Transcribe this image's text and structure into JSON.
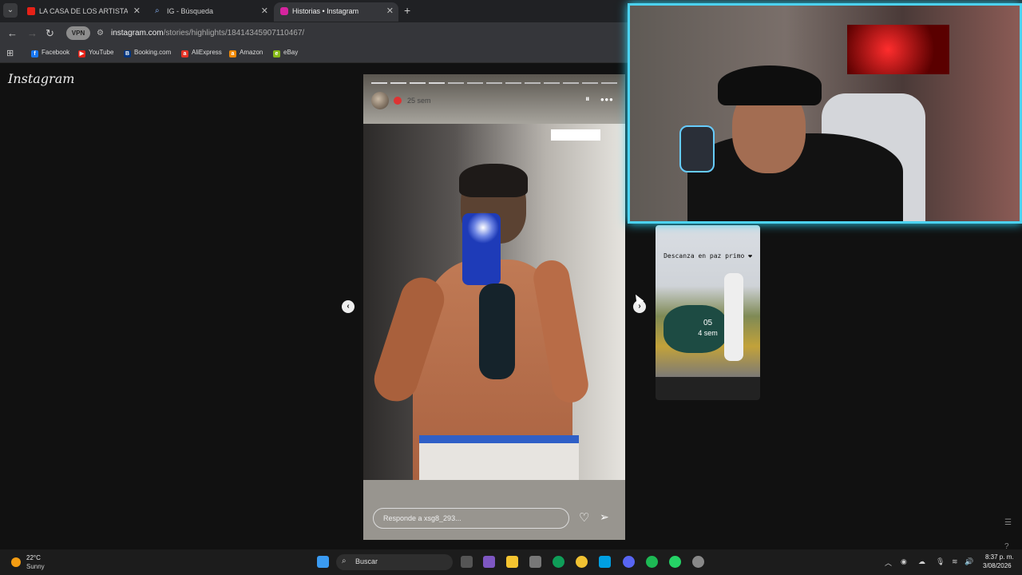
{
  "browser": {
    "tabs": [
      {
        "label": "LA CASA DE LOS ARTISTAS: OV",
        "favicon_color": "#e62117"
      },
      {
        "label": "IG - Búsqueda",
        "favicon_color": "#8ab4f8"
      },
      {
        "label": "Historias • Instagram",
        "favicon_color": "#d6249f"
      }
    ],
    "new_tab_symbol": "+",
    "vpn_label": "VPN",
    "url_domain": "instagram.com",
    "url_path": "/stories/highlights/18414345907110467/",
    "bookmarks": [
      {
        "label": "Facebook",
        "icon": "facebook-icon",
        "color": "#1877f2",
        "glyph": "f"
      },
      {
        "label": "YouTube",
        "icon": "youtube-icon",
        "color": "#e62117",
        "glyph": "▶"
      },
      {
        "label": "Booking.com",
        "icon": "booking-icon",
        "color": "#003580",
        "glyph": "B"
      },
      {
        "label": "AliExpress",
        "icon": "aliexpress-icon",
        "color": "#e43225",
        "glyph": "a"
      },
      {
        "label": "Amazon",
        "icon": "amazon-icon",
        "color": "#f08804",
        "glyph": "a"
      },
      {
        "label": "eBay",
        "icon": "ebay-icon",
        "color": "#86b817",
        "glyph": "e"
      }
    ]
  },
  "instagram": {
    "logo": "Instagram",
    "story": {
      "time_ago": "25 sem",
      "reply_placeholder": "Responde a xsg8_293...",
      "pause_symbol": "⏸",
      "more_symbol": "•••"
    },
    "next_thumb": {
      "caption": "Descanza en paz primo ❤",
      "day": "05",
      "age": "4 sem"
    }
  },
  "taskbar": {
    "weather_temp": "22°C",
    "weather_condition": "Sunny",
    "search_label": "Buscar",
    "time": "8:37 p. m.",
    "date": "3/08/2026"
  },
  "colors": {
    "accent_webcam_border": "#4cd2f0",
    "browser_bg": "#202124",
    "page_bg": "#111111"
  }
}
